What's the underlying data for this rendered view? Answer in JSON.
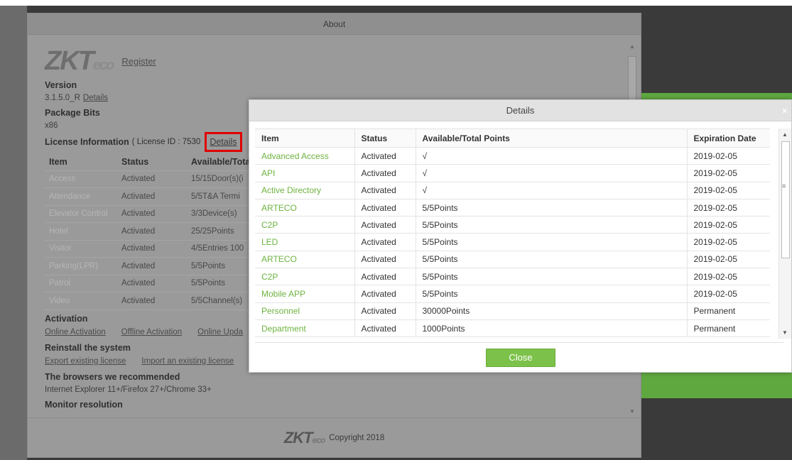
{
  "about": {
    "title": "About",
    "logo": "ZKTeco",
    "register_link": "Register",
    "version_heading": "Version",
    "version_value": "3.1.5.0_R",
    "version_details_link": "Details",
    "package_bits_heading": "Package Bits",
    "package_bits_value": "x86",
    "license_heading": "License Information",
    "license_id_text": "( License ID : 7530",
    "license_details_link": "Details",
    "license_table": {
      "headers": [
        "Item",
        "Status",
        "Available/Tota"
      ],
      "rows": [
        {
          "item": "Access",
          "status": "Activated",
          "value": "15/15Door(s)(i"
        },
        {
          "item": "Attendance",
          "status": "Activated",
          "value": "5/5T&A Termi"
        },
        {
          "item": "Elevator Control",
          "status": "Activated",
          "value": "3/3Device(s)"
        },
        {
          "item": "Hotel",
          "status": "Activated",
          "value": "25/25Points"
        },
        {
          "item": "Visitor",
          "status": "Activated",
          "value": "4/5Entries 100"
        },
        {
          "item": "Parking(LPR)",
          "status": "Activated",
          "value": "5/5Points"
        },
        {
          "item": "Patrol",
          "status": "Activated",
          "value": "5/5Points"
        },
        {
          "item": "Video",
          "status": "Activated",
          "value": "5/5Channel(s)"
        }
      ]
    },
    "activation_heading": "Activation",
    "activation_links": [
      "Online Activation",
      "Offline Activation",
      "Online Upda"
    ],
    "reinstall_heading": "Reinstall the system",
    "reinstall_links": [
      "Export existing license",
      "Import an existing license"
    ],
    "browsers_heading": "The browsers we recommended",
    "browsers_value": "Internet Explorer 11+/Firefox 27+/Chrome 33+",
    "monitor_heading": "Monitor resolution",
    "footer_logo": "ZKTeco",
    "footer_copyright": "Copyright 2018"
  },
  "details": {
    "title": "Details",
    "close_x": "×",
    "headers": [
      "Item",
      "Status",
      "Available/Total Points",
      "Expiration Date"
    ],
    "rows": [
      {
        "item": "Advanced Access",
        "status": "Activated",
        "points": "√",
        "expiration": "2019-02-05"
      },
      {
        "item": "API",
        "status": "Activated",
        "points": "√",
        "expiration": "2019-02-05"
      },
      {
        "item": "Active Directory",
        "status": "Activated",
        "points": "√",
        "expiration": "2019-02-05"
      },
      {
        "item": "ARTECO",
        "status": "Activated",
        "points": "5/5Points",
        "expiration": "2019-02-05"
      },
      {
        "item": "C2P",
        "status": "Activated",
        "points": "5/5Points",
        "expiration": "2019-02-05"
      },
      {
        "item": "LED",
        "status": "Activated",
        "points": "5/5Points",
        "expiration": "2019-02-05"
      },
      {
        "item": "ARTECO",
        "status": "Activated",
        "points": "5/5Points",
        "expiration": "2019-02-05"
      },
      {
        "item": "C2P",
        "status": "Activated",
        "points": "5/5Points",
        "expiration": "2019-02-05"
      },
      {
        "item": "Mobile APP",
        "status": "Activated",
        "points": "5/5Points",
        "expiration": "2019-02-05"
      },
      {
        "item": "Personnel",
        "status": "Activated",
        "points": "30000Points",
        "expiration": "Permanent"
      },
      {
        "item": "Department",
        "status": "Activated",
        "points": "1000Points",
        "expiration": "Permanent"
      }
    ],
    "close_button": "Close"
  },
  "colors": {
    "accent_green": "#7cc24a",
    "item_green": "#6db33f",
    "highlight_red": "#e00000"
  }
}
